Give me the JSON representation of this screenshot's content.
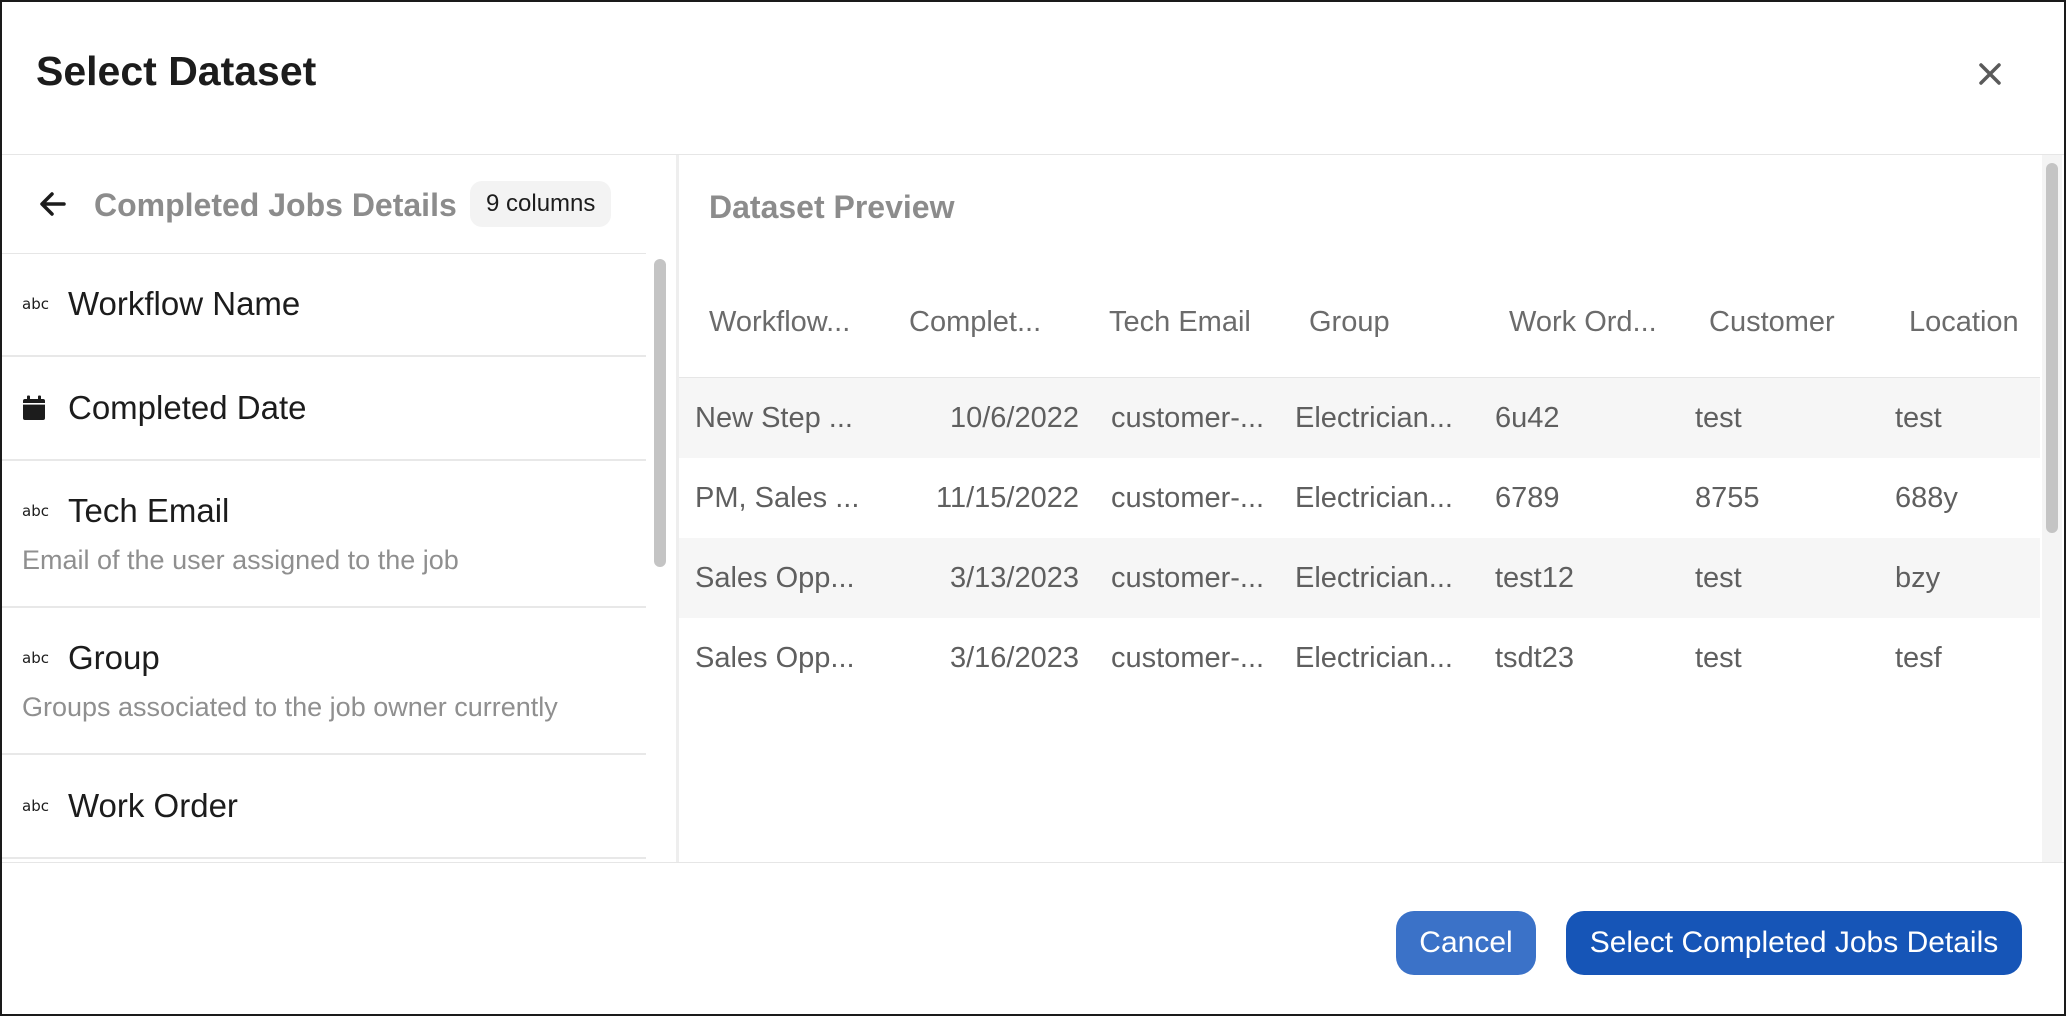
{
  "dialog": {
    "title": "Select Dataset",
    "close_icon": "close-icon"
  },
  "left_panel": {
    "back_icon": "arrow-left-icon",
    "dataset_name": "Completed Jobs Details",
    "column_count": "9 columns",
    "columns": [
      {
        "type": "abc",
        "name": "Workflow Name",
        "description": ""
      },
      {
        "type": "calendar-icon",
        "name": "Completed Date",
        "description": ""
      },
      {
        "type": "abc",
        "name": "Tech Email",
        "description": "Email of the user assigned to the job"
      },
      {
        "type": "abc",
        "name": "Group",
        "description": "Groups associated to the job owner currently"
      },
      {
        "type": "abc",
        "name": "Work Order",
        "description": ""
      }
    ]
  },
  "preview": {
    "title": "Dataset Preview",
    "headers": [
      "Workflow...",
      "Complet...",
      "Tech Email",
      "Group",
      "Work Ord...",
      "Customer",
      "Location"
    ],
    "rows": [
      [
        "New Step ...",
        "10/6/2022",
        "customer-...",
        "Electrician...",
        "6u42",
        "test",
        "test"
      ],
      [
        "PM, Sales ...",
        "11/15/2022",
        "customer-...",
        "Electrician...",
        "6789",
        "8755",
        "688y"
      ],
      [
        "Sales Opp...",
        "3/13/2023",
        "customer-...",
        "Electrician...",
        "test12",
        "test",
        "bzy"
      ],
      [
        "Sales Opp...",
        "3/16/2023",
        "customer-...",
        "Electrician...",
        "tsdt23",
        "test",
        "tesf"
      ]
    ]
  },
  "footer": {
    "cancel_label": "Cancel",
    "select_label": "Select Completed Jobs Details"
  },
  "colors": {
    "primary": "#1655b7",
    "secondary": "#3b72c8",
    "muted_text": "#8c8c8c"
  }
}
